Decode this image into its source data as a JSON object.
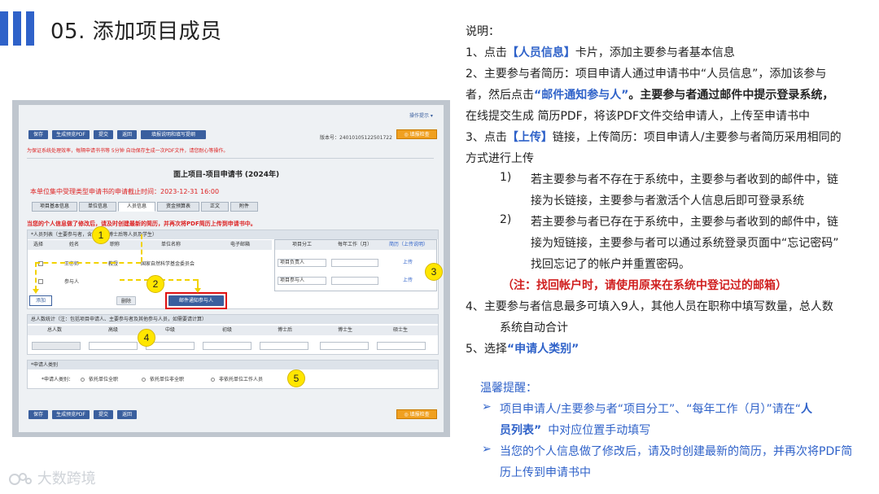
{
  "header": {
    "title": "05. 添加项目成员",
    "accent": "#2f62c9"
  },
  "screenshot": {
    "top_link": "操作提示 ▾",
    "toolbar": [
      "保存",
      "生成预览PDF",
      "提交",
      "返回",
      "填报说明和填写提纲"
    ],
    "version": "版本号：24010105122501722",
    "check_button": "◎ 填报检查",
    "warning": "为保证系统处理效率，每隔申请书书等 5分钟 自动保存生成一次PDF文件，请您耐心等操作。",
    "form_title": "面上项目-项目申请书 (2024年)",
    "deadline": "本单位集中受理类型申请书的申请截止时间：2023-12-31 16:00",
    "tabs": [
      "项目基本信息",
      "单位信息",
      "人员信息",
      "资金预算表",
      "正文",
      "附件"
    ],
    "notice": "当您的个人信息做了修改后，请及时创建最新的简历，并再次将PDF简历上传到申请书中。",
    "member_section": "*人员列表（主要参与者，含研究生/博士后等人员及学生）",
    "left_headers": [
      "选择",
      "姓名",
      "职称",
      "单位名称",
      "电子邮箱"
    ],
    "rows": [
      {
        "name": "王亦师",
        "title": "教授",
        "org": "国家自然科学基金委员会",
        "role": "项目负责人",
        "link": "上传"
      },
      {
        "name": "参与人",
        "title": "",
        "org": "",
        "role": "项目参与人",
        "link": "上传"
      }
    ],
    "right_headers": [
      "项目分工",
      "每年工作（月）",
      "简历（上传说明）"
    ],
    "buttons": {
      "add": "添加",
      "delete": "删除",
      "email_invite": "邮件通知参与人"
    },
    "stats_section": "总人数统计（注：包括项目申请人、主要参与者及其他参与人员，如需要请计算）",
    "stats_headers": [
      "总人数",
      "高级",
      "中级",
      "初级",
      "博士后",
      "博士生",
      "硕士生"
    ],
    "category_section": "*申请人类别",
    "category_label": "*申请人类别：",
    "category_options": [
      "依托单位全职",
      "依托单位非全职",
      "非依托单位工作人员"
    ],
    "bottom_toolbar": [
      "保存",
      "生成预览PDF",
      "提交",
      "返回"
    ],
    "callouts": [
      "1",
      "2",
      "3",
      "4",
      "5"
    ]
  },
  "instructions": {
    "heading": "说明：",
    "l1_a": "1、点击",
    "l1_b": "【人员信息】",
    "l1_c": "卡片，添加主要参与者基本信息",
    "l2_line1": "2、主要参与者简历：项目申请人通过申请书中“人员信息”，添加该参与",
    "l2_line2_a": "者，然后点击",
    "l2_line2_b": "“邮件通知参与人”",
    "l2_line2_c": "。主要参与者通过邮件中提示登录系统，",
    "l2_line3": "在线提交生成 简历PDF，将该PDF文件交给申请人，上传至申请书中",
    "l3_a": "3、点击",
    "l3_b": "【上传】",
    "l3_c": "链接，上传简历：项目申请人/主要参与者简历采用相同的",
    "l3_line2": "方式进行上传",
    "s1_num": "1)",
    "s1_line1": "若主要参与者不存在于系统中，主要参与者收到的邮件中，链",
    "s1_line2": "接为长链接，主要参与者激活个人信息后即可登录系统",
    "s2_num": "2)",
    "s2_line1": "若主要参与者已存在于系统中，主要参与者收到的邮件中，链",
    "s2_line2": "接为短链接，主要参与者可以通过系统登录页面中“忘记密码”",
    "s2_line3": "找回忘记了的帐户并重置密码。",
    "note": "（注：找回帐户时，请使用原来在系统中登记过的邮箱）",
    "l4_line1": "4、主要参与者信息最多可填入9人，其他人员在职称中填写数量，总人数",
    "l4_line2": "系统自动合计",
    "l5_a": "5、选择",
    "l5_b": "“申请人类别”"
  },
  "tips": {
    "heading": "温馨提醒：",
    "t1_a": "项目申请人/主要参与者“项目分工”、“每年工作（月）”请在“",
    "t1_b": "人",
    "t1_c": "员列表”",
    "t1_d": "中对应位置手动填写",
    "t2_line1": "当您的个人信息做了修改后，请及时创建最新的简历，并再次将PDF简",
    "t2_line2": "历上传到申请书中",
    "bullet": "➢"
  },
  "brand": "大数跨境"
}
